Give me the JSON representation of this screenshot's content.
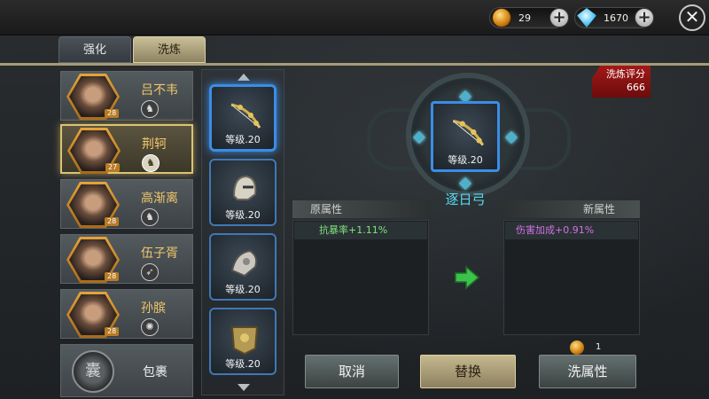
{
  "resources": {
    "gold_count": "29",
    "diamond_count": "1670"
  },
  "tabs": [
    {
      "label": "强化"
    },
    {
      "label": "洗炼"
    }
  ],
  "heroes": [
    {
      "name": "吕不韦",
      "level": "28"
    },
    {
      "name": "荆轲",
      "level": "27"
    },
    {
      "name": "高渐离",
      "level": "28"
    },
    {
      "name": "伍子胥",
      "level": "28"
    },
    {
      "name": "孙膑",
      "level": "28"
    }
  ],
  "bag": {
    "label": "包裹"
  },
  "equipment": [
    {
      "level_text": "等级.20",
      "icon": "bow-icon"
    },
    {
      "level_text": "等级.20",
      "icon": "helmet-icon"
    },
    {
      "level_text": "等级.20",
      "icon": "pauldron-icon"
    },
    {
      "level_text": "等级.20",
      "icon": "armor-icon"
    }
  ],
  "selected_item": {
    "name": "逐日弓",
    "level_text": "等级.20"
  },
  "score": {
    "label": "洗炼评分",
    "value": "666"
  },
  "attributes": {
    "old_header": "原属性",
    "new_header": "新属性",
    "old_value": "抗暴率+1.11%",
    "new_value": "伤害加成+0.91%"
  },
  "buttons": {
    "cancel": "取消",
    "replace": "替换",
    "refine": "洗属性"
  },
  "cost": {
    "count": "1"
  },
  "colors": {
    "accent_gold": "#dcc273",
    "item_name": "#57d9f0",
    "old_attr": "#7ee57a",
    "new_attr": "#d271e6",
    "score_red": "#a31818"
  }
}
